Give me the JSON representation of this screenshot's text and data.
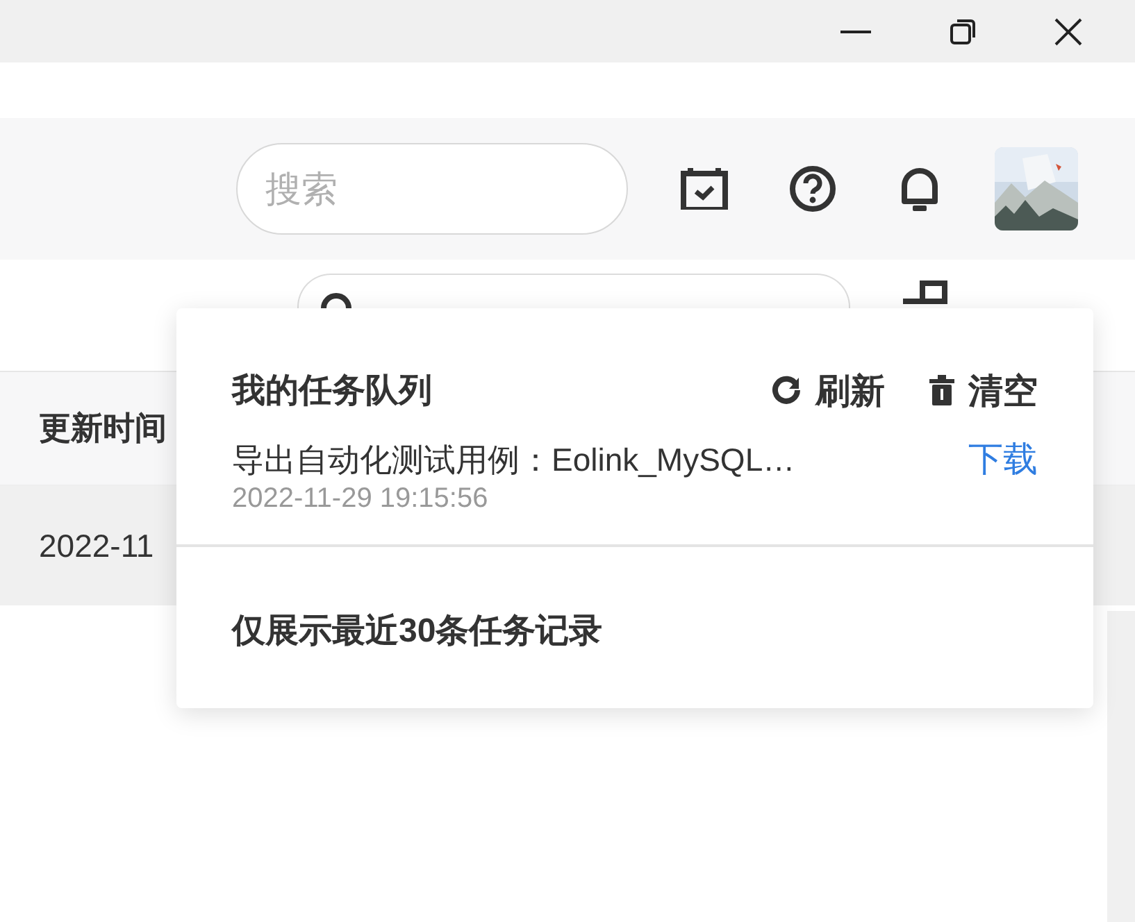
{
  "header": {
    "search": {
      "placeholder": "搜索"
    }
  },
  "table": {
    "columns": [
      "更新时间"
    ],
    "rows": [
      [
        "2022-11"
      ]
    ]
  },
  "task_queue": {
    "title": "我的任务队列",
    "actions": [
      {
        "label": "刷新",
        "kind": "refresh"
      },
      {
        "label": "清空",
        "kind": "clear"
      }
    ],
    "tasks": [
      {
        "name": "导出自动化测试用例：Eolink_MySQL…",
        "time": "2022-11-29 19:15:56",
        "action": "下载"
      }
    ],
    "footer": "仅展示最近30条任务记录"
  }
}
